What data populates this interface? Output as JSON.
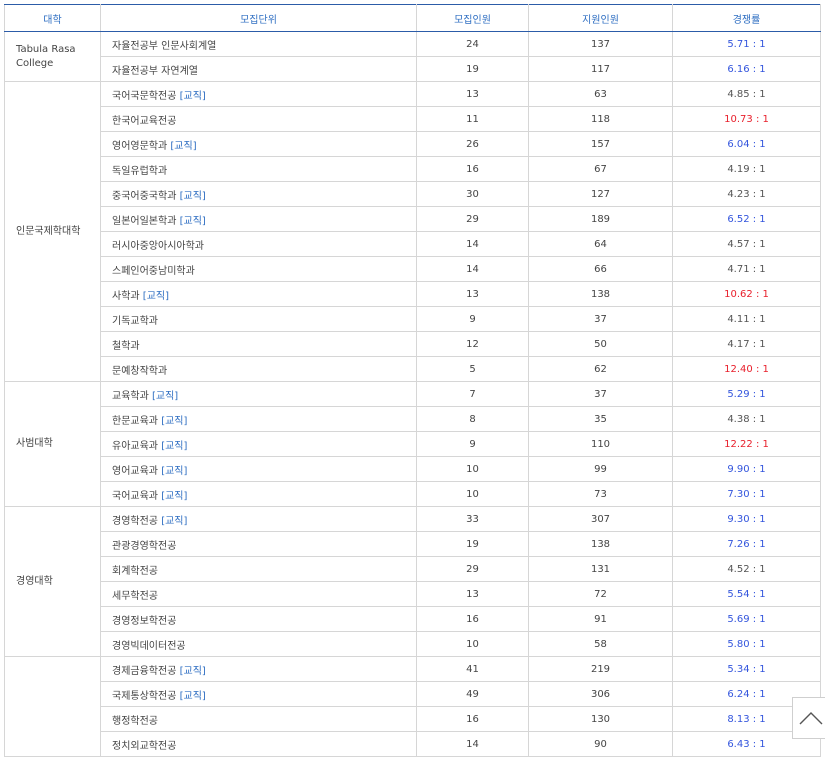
{
  "header": {
    "college": "대학",
    "unit": "모집단위",
    "quota": "모집인원",
    "applicants": "지원인원",
    "rate": "경쟁률"
  },
  "colors": {
    "high": "#e8202c",
    "mid": "#3355dd",
    "low": "#555555",
    "accent": "#2e6ec2"
  },
  "tag_label": "[교직]",
  "groups": [
    {
      "college": "Tabula Rasa College",
      "rows": [
        {
          "unit": "자율전공부 인문사회계열",
          "tag": false,
          "quota": "24",
          "applicants": "137",
          "rate": "5.71 : 1",
          "level": "blue"
        },
        {
          "unit": "자율전공부 자연계열",
          "tag": false,
          "quota": "19",
          "applicants": "117",
          "rate": "6.16 : 1",
          "level": "blue"
        }
      ]
    },
    {
      "college": "인문국제학대학",
      "rows": [
        {
          "unit": "국어국문학전공",
          "tag": true,
          "quota": "13",
          "applicants": "63",
          "rate": "4.85 : 1",
          "level": "gray"
        },
        {
          "unit": "한국어교육전공",
          "tag": false,
          "quota": "11",
          "applicants": "118",
          "rate": "10.73 : 1",
          "level": "red"
        },
        {
          "unit": "영어영문학과",
          "tag": true,
          "quota": "26",
          "applicants": "157",
          "rate": "6.04 : 1",
          "level": "blue"
        },
        {
          "unit": "독일유럽학과",
          "tag": false,
          "quota": "16",
          "applicants": "67",
          "rate": "4.19 : 1",
          "level": "gray"
        },
        {
          "unit": "중국어중국학과",
          "tag": true,
          "quota": "30",
          "applicants": "127",
          "rate": "4.23 : 1",
          "level": "gray"
        },
        {
          "unit": "일본어일본학과",
          "tag": true,
          "quota": "29",
          "applicants": "189",
          "rate": "6.52 : 1",
          "level": "blue"
        },
        {
          "unit": "러시아중앙아시아학과",
          "tag": false,
          "quota": "14",
          "applicants": "64",
          "rate": "4.57 : 1",
          "level": "gray"
        },
        {
          "unit": "스페인어중남미학과",
          "tag": false,
          "quota": "14",
          "applicants": "66",
          "rate": "4.71 : 1",
          "level": "gray"
        },
        {
          "unit": "사학과",
          "tag": true,
          "quota": "13",
          "applicants": "138",
          "rate": "10.62 : 1",
          "level": "red"
        },
        {
          "unit": "기독교학과",
          "tag": false,
          "quota": "9",
          "applicants": "37",
          "rate": "4.11 : 1",
          "level": "gray"
        },
        {
          "unit": "철학과",
          "tag": false,
          "quota": "12",
          "applicants": "50",
          "rate": "4.17 : 1",
          "level": "gray"
        },
        {
          "unit": "문예창작학과",
          "tag": false,
          "quota": "5",
          "applicants": "62",
          "rate": "12.40 : 1",
          "level": "red"
        }
      ]
    },
    {
      "college": "사범대학",
      "rows": [
        {
          "unit": "교육학과",
          "tag": true,
          "quota": "7",
          "applicants": "37",
          "rate": "5.29 : 1",
          "level": "blue"
        },
        {
          "unit": "한문교육과",
          "tag": true,
          "quota": "8",
          "applicants": "35",
          "rate": "4.38 : 1",
          "level": "gray"
        },
        {
          "unit": "유아교육과",
          "tag": true,
          "quota": "9",
          "applicants": "110",
          "rate": "12.22 : 1",
          "level": "red"
        },
        {
          "unit": "영어교육과",
          "tag": true,
          "quota": "10",
          "applicants": "99",
          "rate": "9.90 : 1",
          "level": "blue"
        },
        {
          "unit": "국어교육과",
          "tag": true,
          "quota": "10",
          "applicants": "73",
          "rate": "7.30 : 1",
          "level": "blue"
        }
      ]
    },
    {
      "college": "경영대학",
      "rows": [
        {
          "unit": "경영학전공",
          "tag": true,
          "quota": "33",
          "applicants": "307",
          "rate": "9.30 : 1",
          "level": "blue"
        },
        {
          "unit": "관광경영학전공",
          "tag": false,
          "quota": "19",
          "applicants": "138",
          "rate": "7.26 : 1",
          "level": "blue"
        },
        {
          "unit": "회계학전공",
          "tag": false,
          "quota": "29",
          "applicants": "131",
          "rate": "4.52 : 1",
          "level": "gray"
        },
        {
          "unit": "세무학전공",
          "tag": false,
          "quota": "13",
          "applicants": "72",
          "rate": "5.54 : 1",
          "level": "blue"
        },
        {
          "unit": "경영정보학전공",
          "tag": false,
          "quota": "16",
          "applicants": "91",
          "rate": "5.69 : 1",
          "level": "blue"
        },
        {
          "unit": "경영빅데이터전공",
          "tag": false,
          "quota": "10",
          "applicants": "58",
          "rate": "5.80 : 1",
          "level": "blue"
        }
      ]
    },
    {
      "college": "",
      "rows": [
        {
          "unit": "경제금융학전공",
          "tag": true,
          "quota": "41",
          "applicants": "219",
          "rate": "5.34 : 1",
          "level": "blue"
        },
        {
          "unit": "국제통상학전공",
          "tag": true,
          "quota": "49",
          "applicants": "306",
          "rate": "6.24 : 1",
          "level": "blue"
        },
        {
          "unit": "행정학전공",
          "tag": false,
          "quota": "16",
          "applicants": "130",
          "rate": "8.13 : 1",
          "level": "blue"
        },
        {
          "unit": "정치외교학전공",
          "tag": false,
          "quota": "14",
          "applicants": "90",
          "rate": "6.43 : 1",
          "level": "blue"
        }
      ]
    }
  ],
  "scroll_top_icon": "chevron-up-icon"
}
